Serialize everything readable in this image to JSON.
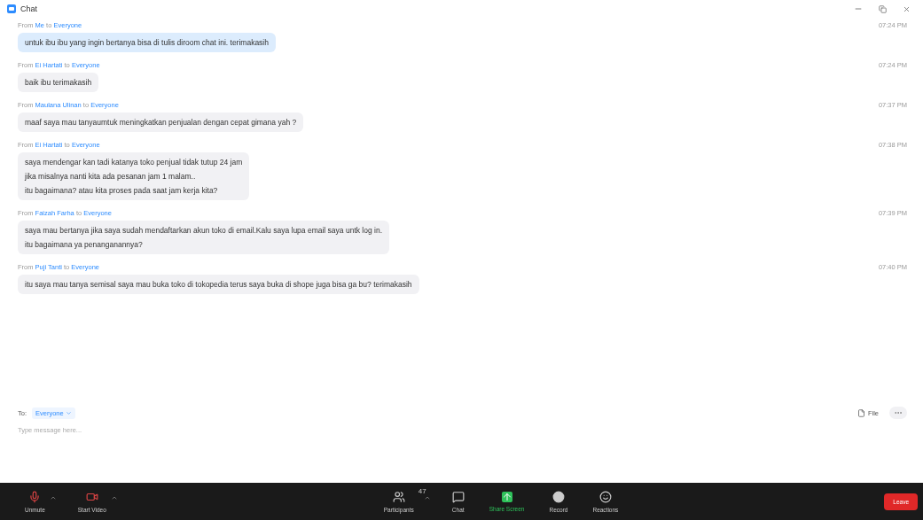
{
  "window": {
    "title": "Chat"
  },
  "messages": [
    {
      "prefix": "From",
      "sender": "Me",
      "joiner": "to",
      "recipient": "Everyone",
      "time": "07:24 PM",
      "own": true,
      "lines": [
        "untuk ibu ibu yang ingin bertanya bisa di tulis diroom chat ini. terimakasih"
      ]
    },
    {
      "prefix": "From",
      "sender": "Ei Hartati",
      "joiner": "to",
      "recipient": "Everyone",
      "time": "07:24 PM",
      "own": false,
      "lines": [
        "baik ibu terimakasih"
      ]
    },
    {
      "prefix": "From",
      "sender": "Maulana Ulinan",
      "joiner": "to",
      "recipient": "Everyone",
      "time": "07:37 PM",
      "own": false,
      "lines": [
        "maaf  saya mau tanyaumtuk meningkatkan penjualan dengan cepat gimana yah ?"
      ]
    },
    {
      "prefix": "From",
      "sender": "Ei Hartati",
      "joiner": "to",
      "recipient": "Everyone",
      "time": "07:38 PM",
      "own": false,
      "lines": [
        "saya mendengar kan tadi katanya toko penjual tidak tutup 24 jam",
        "jika misalnya nanti kita ada pesanan jam 1 malam..",
        "itu bagaimana? atau kita proses pada saat jam kerja kita?"
      ]
    },
    {
      "prefix": "From",
      "sender": "Faizah Farha",
      "joiner": "to",
      "recipient": "Everyone",
      "time": "07:39 PM",
      "own": false,
      "lines": [
        "saya mau bertanya jika saya sudah mendaftarkan akun toko di email.Kalu saya lupa email saya untk log in.",
        "itu bagaimana ya penanganannya?"
      ]
    },
    {
      "prefix": "From",
      "sender": "Puji Tanti",
      "joiner": "to",
      "recipient": "Everyone",
      "time": "07:40 PM",
      "own": false,
      "lines": [
        "itu saya mau tanya semisal saya mau buka toko di tokopedia terus saya buka di shope juga bisa ga bu? terimakasih"
      ]
    }
  ],
  "compose": {
    "to_label": "To:",
    "recipient": "Everyone",
    "placeholder": "Type message here...",
    "file_label": "File"
  },
  "toolbar": {
    "left": [
      {
        "kind": "mic",
        "label": "Unmute"
      },
      {
        "kind": "video",
        "label": "Start Video"
      }
    ],
    "center": [
      {
        "kind": "participants",
        "label": "Participants",
        "count": "47"
      },
      {
        "kind": "chat",
        "label": "Chat"
      },
      {
        "kind": "share",
        "label": "Share Screen"
      },
      {
        "kind": "record",
        "label": "Record"
      },
      {
        "kind": "reactions",
        "label": "Reactions"
      }
    ],
    "leave": "Leave"
  }
}
